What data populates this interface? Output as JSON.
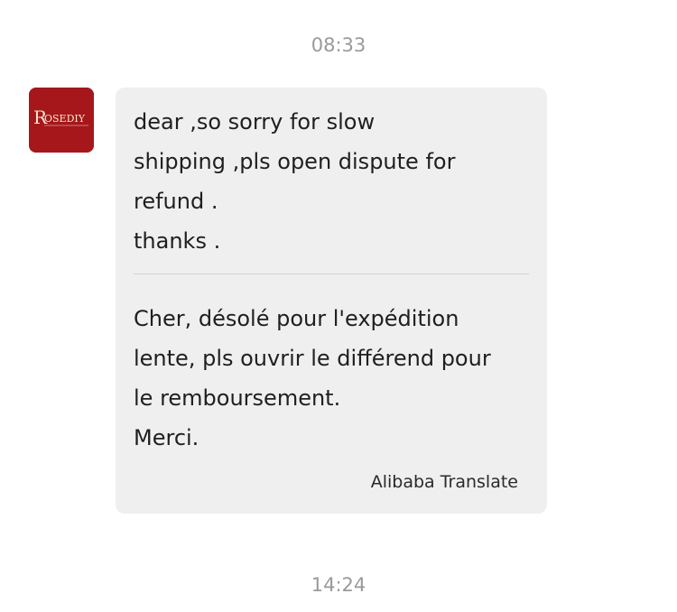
{
  "timestamps": [
    "08:33",
    "14:24"
  ],
  "sender": {
    "avatar_logo_text": "ROSEDIY",
    "avatar_color": "#a5171b"
  },
  "message": {
    "original_lines": [
      "dear ,so sorry for slow",
      "shipping ,pls open dispute for",
      "refund .",
      "thanks ."
    ],
    "translated_lines": [
      "Cher, désolé pour l'expédition",
      "lente, pls ouvrir le différend pour",
      "le remboursement.",
      "Merci."
    ],
    "translation_provider": "Alibaba Translate"
  },
  "colors": {
    "bubble_background": "#efefef",
    "timestamp_text": "#9a9a9a",
    "divider": "#cdd4d9"
  }
}
